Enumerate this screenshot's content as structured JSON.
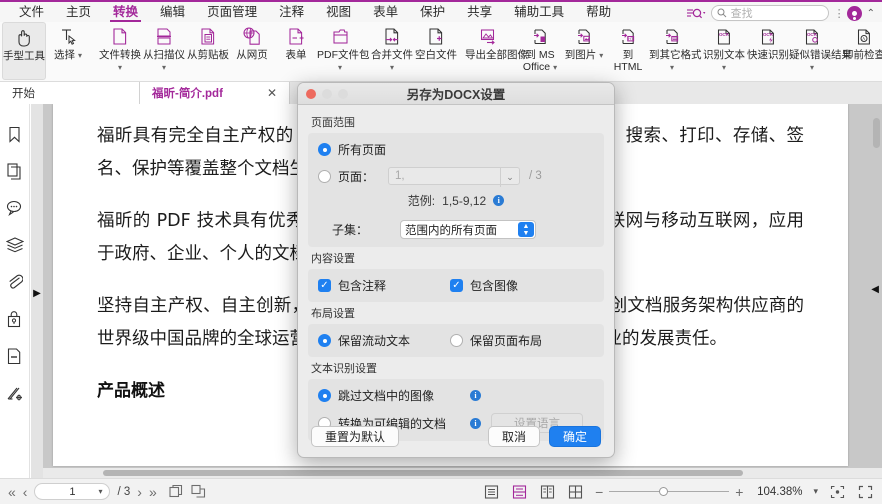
{
  "menu": {
    "items": [
      {
        "label": "文件",
        "active": false
      },
      {
        "label": "主页",
        "active": false
      },
      {
        "label": "转换",
        "active": true
      },
      {
        "label": "编辑",
        "active": false
      },
      {
        "label": "页面管理",
        "active": false
      },
      {
        "label": "注释",
        "active": false
      },
      {
        "label": "视图",
        "active": false
      },
      {
        "label": "表单",
        "active": false
      },
      {
        "label": "保护",
        "active": false
      },
      {
        "label": "共享",
        "active": false
      },
      {
        "label": "辅助工具",
        "active": false
      },
      {
        "label": "帮助",
        "active": false
      }
    ],
    "search_placeholder": "查找",
    "accent_color": "#a3289a"
  },
  "ribbon": {
    "items": [
      {
        "label": "手型工具",
        "icon": "hand-icon",
        "selected": true,
        "caret": false
      },
      {
        "label": "选择",
        "icon": "select-cursor-icon",
        "selected": false,
        "caret": true
      },
      {
        "label": "文件转换",
        "icon": "file-convert-icon",
        "selected": false,
        "caret": true
      },
      {
        "label": "从扫描仪",
        "icon": "scanner-icon",
        "selected": false,
        "caret": true
      },
      {
        "label": "从剪贴板",
        "icon": "clipboard-icon",
        "selected": false,
        "caret": false
      },
      {
        "label": "从网页",
        "icon": "web-icon",
        "selected": false,
        "caret": false
      },
      {
        "label": "表单",
        "icon": "form-icon",
        "selected": false,
        "caret": false
      },
      {
        "label": "PDF文件包",
        "icon": "pdf-portfolio-icon",
        "selected": false,
        "caret": true
      },
      {
        "label": "合并文件",
        "icon": "merge-files-icon",
        "selected": false,
        "caret": true
      },
      {
        "label": "空白文件",
        "icon": "blank-file-icon",
        "selected": false,
        "caret": false
      },
      {
        "label": "导出全部图像",
        "icon": "export-images-icon",
        "selected": false,
        "caret": false
      },
      {
        "label": "到 MS Office",
        "icon": "to-ms-office-icon",
        "selected": false,
        "caret": true
      },
      {
        "label": "到图片",
        "icon": "to-image-icon",
        "selected": false,
        "caret": true
      },
      {
        "label": "到 HTML",
        "icon": "to-html-icon",
        "selected": false,
        "caret": false
      },
      {
        "label": "到其它格式",
        "icon": "to-other-format-icon",
        "selected": false,
        "caret": true
      },
      {
        "label": "识别文本",
        "icon": "ocr-text-icon",
        "selected": false,
        "caret": true
      },
      {
        "label": "快速识别",
        "icon": "ocr-quick-icon",
        "selected": false,
        "caret": false
      },
      {
        "label": "疑似错误结果",
        "icon": "ocr-suspect-icon",
        "selected": false,
        "caret": true
      },
      {
        "label": "印前检查",
        "icon": "preflight-icon",
        "selected": false,
        "caret": false
      }
    ],
    "separators_after": [
      1,
      7,
      9,
      10,
      14,
      17
    ]
  },
  "tabs": [
    {
      "label": "开始",
      "active": false
    },
    {
      "label": "福昕-简介.pdf",
      "active": true,
      "close": "✕"
    }
  ],
  "sidebar": {
    "items": [
      {
        "name": "bookmark-icon"
      },
      {
        "name": "pages-icon"
      },
      {
        "name": "comments-icon"
      },
      {
        "name": "layers-icon"
      },
      {
        "name": "attachment-icon"
      },
      {
        "name": "security-icon"
      },
      {
        "name": "fields-icon"
      },
      {
        "name": "signature-icon"
      }
    ],
    "expand_arrow": "▶"
  },
  "document": {
    "paragraphs": [
      "福昕具有完全自主产权的 PDF 核心技术，提供创建、显示、编辑、搜索、打印、存储、签名、保护等覆盖整个文档生命周期的产品技术与解决方案。",
      "福昕的 PDF 技术具有优秀的跨平台能力，产品服务覆盖桌面、互联网与移动互联网，应用于政府、企业、个人的文档应用服务领域。",
      "坚持自主产权、自主创新，推动中国文档技术应用的创新，努力开创文档服务架构供应商的世界级中国品牌的全球运营管理文化，福昕将不断推动中国软件产业的发展责任。"
    ],
    "heading": "产品概述"
  },
  "dialog": {
    "title": "另存为DOCX设置",
    "groups": {
      "page_range": {
        "label": "页面范围",
        "all_pages": "所有页面",
        "all_pages_selected": true,
        "pages_label": "页面：",
        "pages_selected": false,
        "pages_value": "",
        "pages_placeholder": "1,",
        "total_pages": "/  3",
        "example_label": "范例:",
        "example_value": "1,5-9,12",
        "info_icon": "i",
        "subset_label": "子集：",
        "subset_value": "范围内的所有页面"
      },
      "content": {
        "label": "内容设置",
        "include_comments": "包含注释",
        "include_comments_checked": true,
        "include_images": "包含图像",
        "include_images_checked": true
      },
      "layout": {
        "label": "布局设置",
        "flowing_text": "保留流动文本",
        "flowing_text_selected": true,
        "page_layout": "保留页面布局",
        "page_layout_selected": false
      },
      "ocr": {
        "label": "文本识别设置",
        "skip_images": "跳过文档中的图像",
        "skip_images_selected": true,
        "convert_editable": "转换为可编辑的文档",
        "convert_editable_selected": false,
        "language_button": "设置语言"
      }
    },
    "buttons": {
      "reset": "重置为默认",
      "cancel": "取消",
      "ok": "确定"
    },
    "primary_color": "#1f80f0"
  },
  "status": {
    "first_page_icon": "«",
    "prev_page_icon": "‹",
    "current_page": "1",
    "total_pages": "/ 3",
    "next_page_icon": "›",
    "last_page_icon": "»",
    "view_modes": [
      "single-page-icon",
      "continuous-icon",
      "facing-icon",
      "facing-cover-icon"
    ],
    "active_view_mode": 1,
    "zoom_out": "−",
    "zoom_in": "+",
    "zoom_level": "104.38%",
    "zoom_caret": "▾"
  }
}
